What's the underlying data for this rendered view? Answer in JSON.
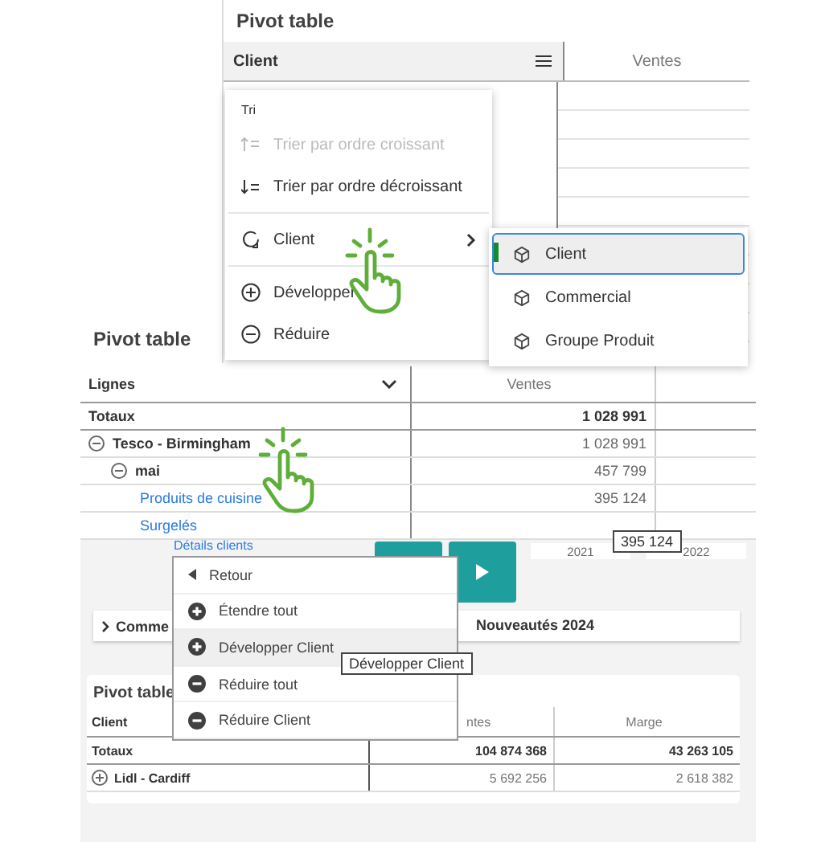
{
  "top_panel": {
    "title": "Pivot table",
    "header": {
      "label": "Client",
      "column": "Ventes"
    },
    "sort_menu": {
      "section": "Tri",
      "items": [
        {
          "kind": "sort-asc",
          "label": "Trier par ordre croissant",
          "disabled": true
        },
        {
          "kind": "sort-desc",
          "label": "Trier par ordre décroissant",
          "disabled": false
        },
        {
          "kind": "field",
          "label": "Client",
          "disabled": false
        },
        {
          "kind": "expand",
          "label": "Développer",
          "disabled": false
        },
        {
          "kind": "collapse",
          "label": "Réduire",
          "disabled": false
        }
      ]
    },
    "field_submenu": [
      {
        "label": "Client",
        "selected": true
      },
      {
        "label": "Commercial",
        "selected": false
      },
      {
        "label": "Groupe Produit",
        "selected": false
      }
    ]
  },
  "middle_panel": {
    "title": "Pivot table",
    "header": {
      "label": "Lignes",
      "column": "Ventes"
    },
    "totals": {
      "label": "Totaux",
      "value": "1 028 991"
    },
    "rows": [
      {
        "label": "Tesco - Birmingham",
        "value": "1 028 991",
        "expanded": true,
        "children": [
          {
            "label": "mai",
            "value": "457 799",
            "expanded": true,
            "children": [
              {
                "label": "Produits de cuisine",
                "value": "395 124"
              },
              {
                "label": "Surgelés"
              }
            ]
          }
        ]
      }
    ],
    "value_tooltip": "395 124"
  },
  "background": {
    "link": "Détails clients",
    "years": [
      "2021",
      "2022"
    ],
    "section_bar": {
      "label": "Comme",
      "title": "Nouveautés 2024"
    },
    "pivot": {
      "title": "Pivot table",
      "columns": [
        "Client",
        "ntes",
        "Marge"
      ],
      "totals": {
        "label": "Totaux",
        "values": [
          "104 874 368",
          "43 263 105"
        ]
      },
      "rows": [
        {
          "label": "Lidl - Cardiff",
          "expanded": false,
          "values": [
            "5 692 256",
            "2 618 382"
          ]
        }
      ]
    }
  },
  "context_menu": {
    "items": [
      {
        "kind": "back",
        "label": "Retour",
        "selected": false
      },
      {
        "kind": "expand",
        "label": "Étendre tout",
        "selected": false
      },
      {
        "kind": "expand",
        "label": "Développer Client",
        "selected": true
      },
      {
        "kind": "collapse",
        "label": "Réduire tout",
        "selected": false
      },
      {
        "kind": "collapse",
        "label": "Réduire Client",
        "selected": false
      }
    ],
    "tooltip": "Développer Client"
  }
}
